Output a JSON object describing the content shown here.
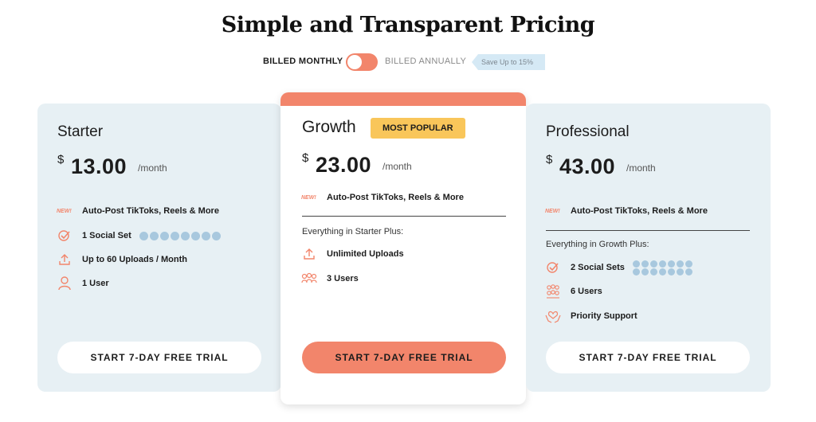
{
  "header": {
    "title": "Simple and Transparent Pricing"
  },
  "billing": {
    "monthly_label": "BILLED MONTHLY",
    "annually_label": "BILLED ANNUALLY",
    "save_label": "Save Up to 15%"
  },
  "colors": {
    "accent": "#f2856b",
    "badge": "#f9c65a",
    "card_bg": "#e7f0f4",
    "save_tag_bg": "#d5e9f5"
  },
  "plans": {
    "starter": {
      "name": "Starter",
      "currency": "$",
      "amount": "13.00",
      "per": "/month",
      "new_tag": "NEW!",
      "autopost": "Auto-Post TikToks, Reels & More",
      "features": [
        "1 Social Set",
        "Up to 60 Uploads / Month",
        "1 User"
      ],
      "cta": "START 7-DAY FREE TRIAL"
    },
    "growth": {
      "name": "Growth",
      "badge": "MOST POPULAR",
      "currency": "$",
      "amount": "23.00",
      "per": "/month",
      "new_tag": "NEW!",
      "autopost": "Auto-Post TikToks, Reels & More",
      "subhead": "Everything in Starter Plus:",
      "features": [
        "Unlimited Uploads",
        "3 Users"
      ],
      "cta": "START 7-DAY FREE TRIAL"
    },
    "professional": {
      "name": "Professional",
      "currency": "$",
      "amount": "43.00",
      "per": "/month",
      "new_tag": "NEW!",
      "autopost": "Auto-Post TikToks, Reels & More",
      "subhead": "Everything in Growth Plus:",
      "features": [
        "2 Social Sets",
        "6 Users",
        "Priority Support"
      ],
      "cta": "START 7-DAY FREE TRIAL"
    }
  }
}
